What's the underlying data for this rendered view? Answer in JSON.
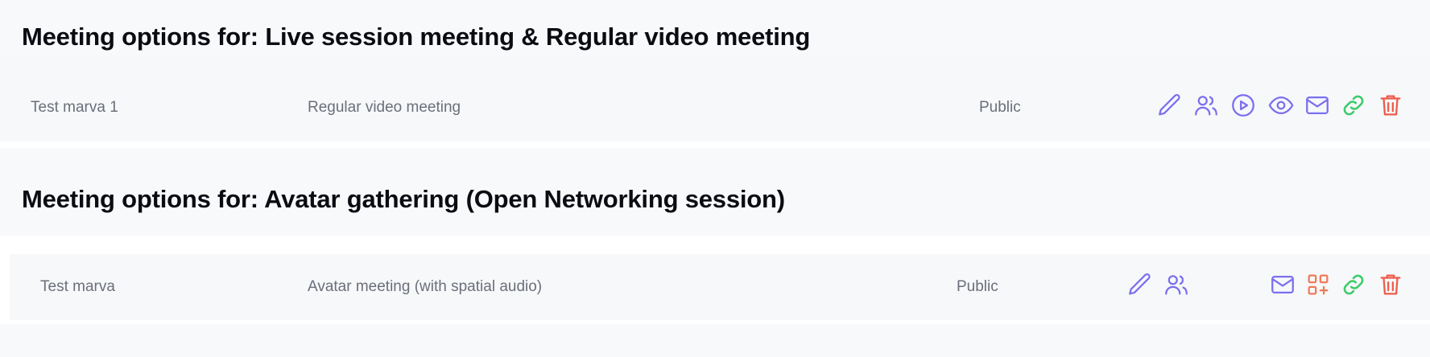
{
  "sections": [
    {
      "title": "Meeting options for: Live session meeting & Regular video meeting",
      "rows": [
        {
          "name": "Test marva 1",
          "type": "Regular video meeting",
          "visibility": "Public",
          "actions": [
            "edit-icon",
            "participants-icon",
            "play-icon",
            "preview-icon",
            "email-icon",
            "copy-link-icon",
            "delete-icon"
          ]
        }
      ]
    },
    {
      "title": "Meeting options for: Avatar gathering (Open Networking session)",
      "rows": [
        {
          "name": "Test marva",
          "type": "Avatar meeting (with spatial audio)",
          "visibility": "Public",
          "actions": [
            "edit-icon",
            "participants-icon",
            "email-icon",
            "qr-code-icon",
            "copy-link-icon",
            "delete-icon"
          ]
        }
      ]
    }
  ],
  "colors": {
    "accent": "#7b6ff0",
    "link": "#3ecb6a",
    "danger": "#ef5a4a",
    "qr": "#f07a57",
    "text": "#6b6f7a"
  }
}
